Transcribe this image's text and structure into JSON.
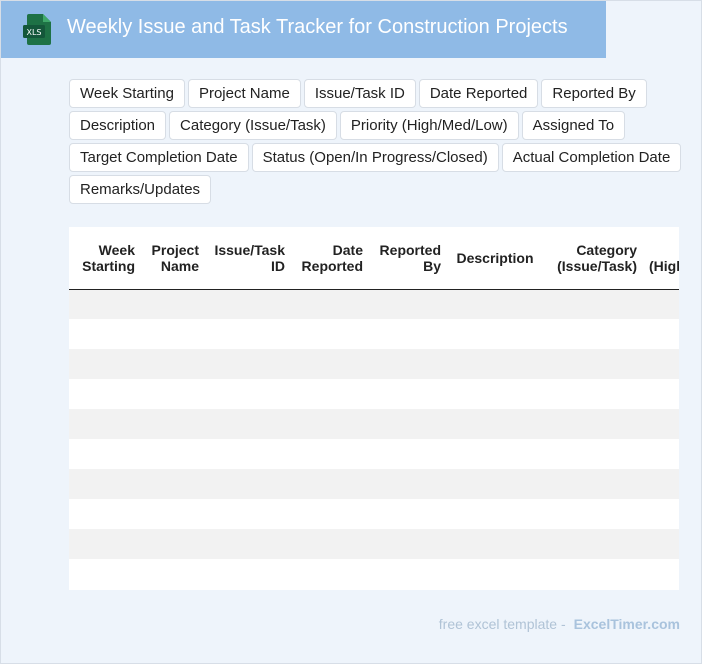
{
  "header": {
    "title": "Weekly Issue and Task Tracker for Construction Projects",
    "icon": "xls-file-icon",
    "icon_label": "XLS"
  },
  "fields": [
    "Week Starting",
    "Project Name",
    "Issue/Task ID",
    "Date Reported",
    "Reported By",
    "Description",
    "Category (Issue/Task)",
    "Priority (High/Med/Low)",
    "Assigned To",
    "Target Completion Date",
    "Status (Open/In Progress/Closed)",
    "Actual Completion Date",
    "Remarks/Updates"
  ],
  "table": {
    "columns": [
      {
        "line1": "Week",
        "line2": "Starting"
      },
      {
        "line1": "Project",
        "line2": "Name"
      },
      {
        "line1": "Issue/Task",
        "line2": "ID"
      },
      {
        "line1": "Date",
        "line2": "Reported"
      },
      {
        "line1": "Reported",
        "line2": "By"
      },
      {
        "line1": "Description",
        "line2": ""
      },
      {
        "line1": "Category",
        "line2": "(Issue/Task)"
      },
      {
        "line1": "",
        "line2": "(High"
      }
    ]
  },
  "footer": {
    "prefix": "free excel template -",
    "brand": "ExcelTimer.com"
  },
  "colors": {
    "header_bg": "#8fbae6",
    "page_bg": "#eef4fb",
    "excel_green": "#1e7145"
  }
}
